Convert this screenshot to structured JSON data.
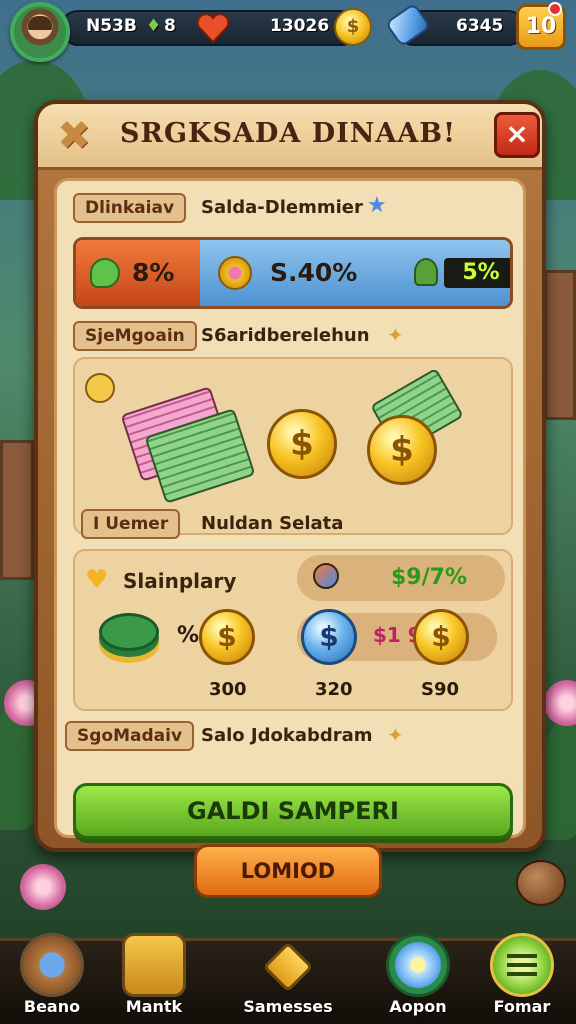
{
  "colors": {
    "accent_green": "#5aa81e",
    "accent_orange": "#e06a12",
    "close_red": "#c02a18",
    "panel_parchment": "#f3dfb6"
  },
  "hud": {
    "resource_1": "N53B",
    "resource_1_suffix": "8",
    "hearts_value": "13026",
    "gems_value": "6345",
    "level": "10",
    "icons": [
      "avatar",
      "heart-icon",
      "coin-icon",
      "gem-icon",
      "level-badge"
    ]
  },
  "dialog": {
    "title": "SRGKSADA DINAAB!",
    "close_label": "×",
    "row1": {
      "tag": "Dlinkaiav",
      "text": "Salda-Dlemmier"
    },
    "stats": {
      "left_value": "8%",
      "middle_value": "S.40%",
      "right_value": "5%"
    },
    "row2": {
      "tag": "SjeMgoain",
      "text": "S6aridberelehun"
    },
    "row3": {
      "tag": "I Uemer",
      "text": "Nuldan Selata"
    },
    "rewards": {
      "heading": "Slainplary",
      "top_right_value": "$9/7%",
      "percent_sign": "%",
      "mid_value": "$1 9",
      "amounts": [
        "300",
        "320",
        "S90"
      ]
    },
    "row4": {
      "tag": "SgoMadaiv",
      "text": "Salo Jdokabdram"
    },
    "cta_label": "GALDI SAMPERI"
  },
  "secondary_button_label": "LOMIOD",
  "bottom_nav": [
    {
      "label": "Beano",
      "icon": "pencil-icon"
    },
    {
      "label": "Mantk",
      "icon": "chest-icon"
    },
    {
      "label": "Samesses",
      "icon": "tag-icon"
    },
    {
      "label": "Aopon",
      "icon": "flower-icon"
    },
    {
      "label": "Fomar",
      "icon": "menu-icon"
    }
  ]
}
